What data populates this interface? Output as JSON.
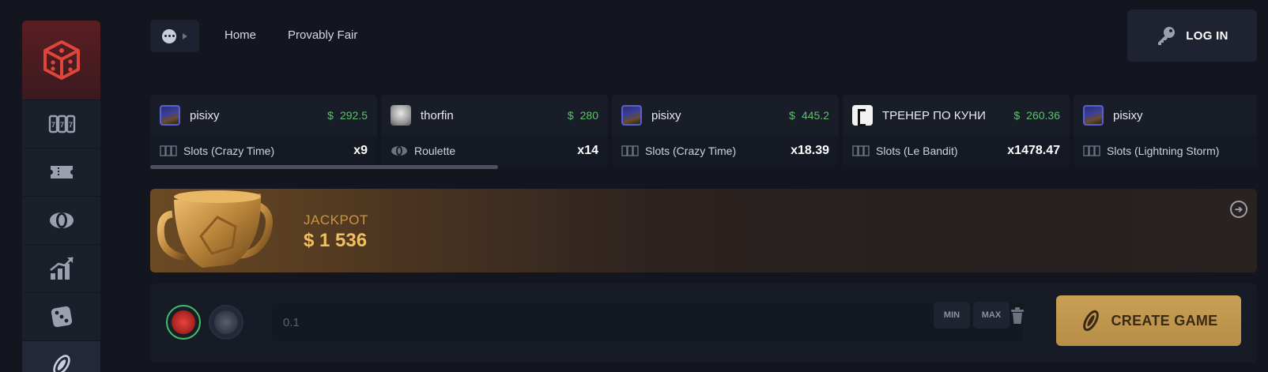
{
  "header": {
    "nav": [
      "Home",
      "Provably Fair"
    ],
    "login_label": "LOG IN"
  },
  "bets": [
    {
      "user": "pisixy",
      "currency": "$",
      "amount": "292.5",
      "game": "Slots (Crazy Time)",
      "multiplier": "x9",
      "avatar": "pisixy",
      "game_icon": "slots-icon"
    },
    {
      "user": "thorfin",
      "currency": "$",
      "amount": "280",
      "game": "Roulette",
      "multiplier": "x14",
      "avatar": "thorfin",
      "game_icon": "roulette-icon"
    },
    {
      "user": "pisixy",
      "currency": "$",
      "amount": "445.2",
      "game": "Slots (Crazy Time)",
      "multiplier": "x18.39",
      "avatar": "pisixy",
      "game_icon": "slots-icon"
    },
    {
      "user": "ТРЕНЕР ПО КУНИ",
      "currency": "$",
      "amount": "260.36",
      "game": "Slots (Le Bandit)",
      "multiplier": "x1478.47",
      "avatar": "trener",
      "game_icon": "slots-icon"
    },
    {
      "user": "pisixy",
      "currency": "",
      "amount": "",
      "game": "Slots (Lightning Storm)",
      "multiplier": "",
      "avatar": "pisixy",
      "game_icon": "slots-icon"
    }
  ],
  "jackpot": {
    "label": "JACKPOT",
    "value": "$ 1 536"
  },
  "create": {
    "amount_value": "0.1",
    "min_label": "MIN",
    "max_label": "MAX",
    "button_label": "CREATE GAME"
  },
  "colors": {
    "accent_gold": "#c99f54",
    "win_green": "#5cc26a",
    "logo_red": "#e8433d"
  }
}
